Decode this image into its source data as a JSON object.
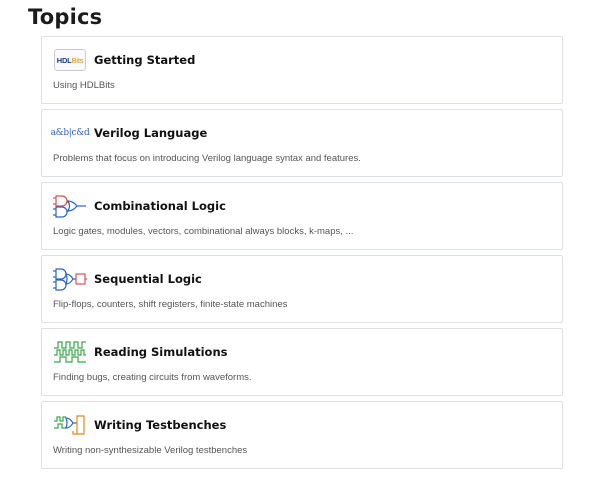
{
  "page": {
    "title": "Topics"
  },
  "topics": [
    {
      "icon": "hdlbits-logo-icon",
      "logo_text_a": "HDL",
      "logo_text_b": "Bits",
      "title": "Getting Started",
      "description": "Using HDLBits"
    },
    {
      "icon": "verilog-operators-icon",
      "logo_text": "a&b|c&d",
      "title": "Verilog Language",
      "description": "Problems that focus on introducing Verilog language syntax and features."
    },
    {
      "icon": "logic-gates-icon",
      "title": "Combinational Logic",
      "description": "Logic gates, modules, vectors, combinational always blocks, k-maps, ..."
    },
    {
      "icon": "flip-flop-icon",
      "title": "Sequential Logic",
      "description": "Flip-flops, counters, shift registers, finite-state machines"
    },
    {
      "icon": "waveform-icon",
      "title": "Reading Simulations",
      "description": "Finding bugs, creating circuits from waveforms."
    },
    {
      "icon": "testbench-icon",
      "title": "Writing Testbenches",
      "description": "Writing non-synthesizable Verilog testbenches"
    }
  ],
  "colors": {
    "card_border": "#dcdfe3",
    "icon_blue": "#2b63c4",
    "icon_red": "#d9534f",
    "icon_green": "#3aa64a",
    "icon_orange": "#e08a1e"
  }
}
